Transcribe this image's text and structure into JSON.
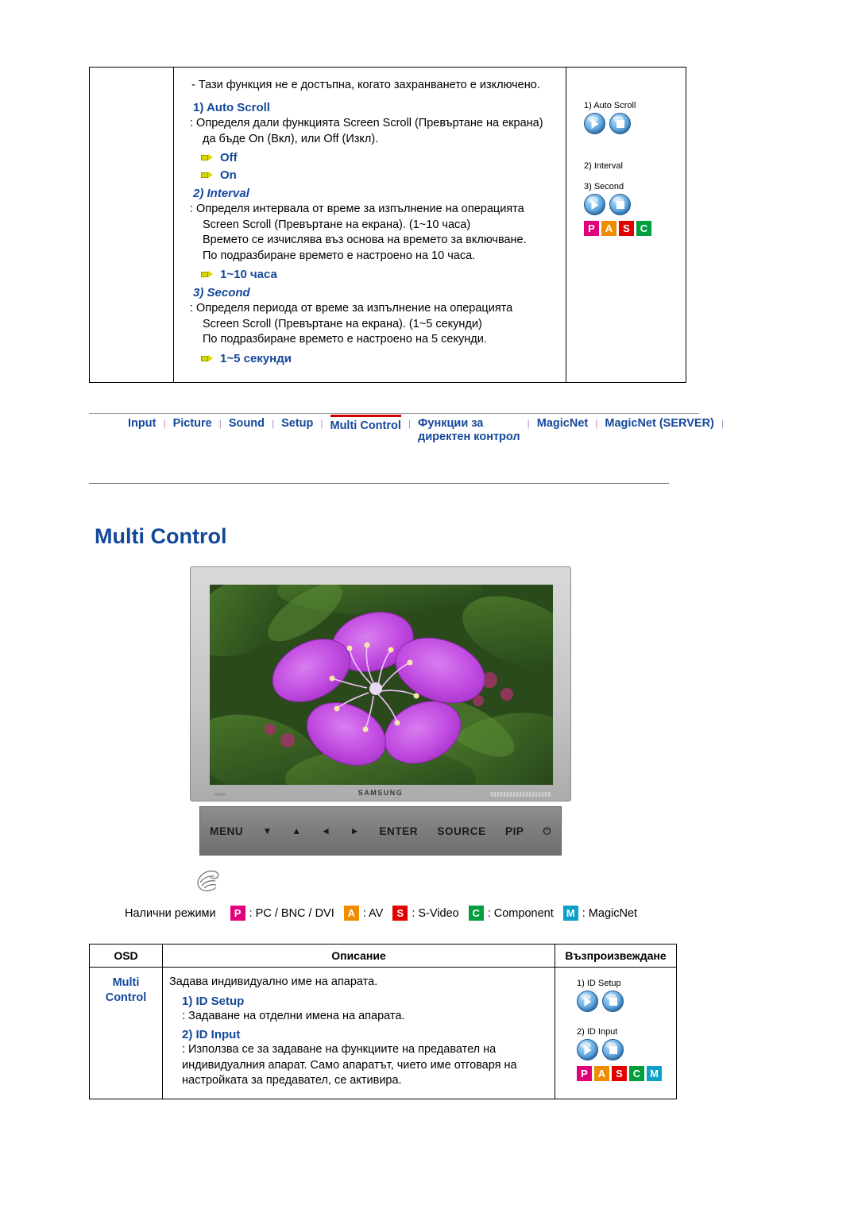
{
  "top_section": {
    "note": "- Тази функция не е достъпна, когато захранването е изключено.",
    "item1_title": "1) Auto Scroll",
    "item1_desc": ": Определя дали функцията Screen Scroll (Превъртане на екрана)\nда бъде On (Вкл), или Off (Изкл).",
    "item1_desc_line1": ": Определя дали функцията Screen Scroll (Превъртане на екрана)",
    "item1_desc_line2": "да бъде On (Вкл), или Off (Изкл).",
    "option_off": "Off",
    "option_on": "On",
    "item2_title": "2) Interval",
    "item2_line1": ": Определя интервала от време за изпълнение на операцията",
    "item2_line2": "Screen Scroll (Превъртане на екрана). (1~10 часа)",
    "item2_line3": "Времето се изчислява въз основа на времето за включване.",
    "item2_line4": "По подразбиране времето е настроено на 10 часа.",
    "option_hours": "1~10 часа",
    "item3_title": "3) Second",
    "item3_line1": ":  Определя периода от време за изпълнение на операцията",
    "item3_line2": "Screen Scroll (Превъртане на екрана). (1~5 секунди)",
    "item3_line3": "По подразбиране времето е настроено на 5 секунди.",
    "option_seconds": "1~5 секунди",
    "icon_label_1": "1) Auto Scroll",
    "icon_label_2": "2) Interval",
    "icon_label_3": "3) Second",
    "tags": [
      "P",
      "A",
      "S",
      "C"
    ]
  },
  "navbar": {
    "items": [
      {
        "label": "Input",
        "active": false
      },
      {
        "label": "Picture",
        "active": false
      },
      {
        "label": "Sound",
        "active": false
      },
      {
        "label": "Setup",
        "active": false
      },
      {
        "label": "Multi Control",
        "active": true
      },
      {
        "label": "Функции за\nдиректен контрол",
        "active": false
      },
      {
        "label": "MagicNet",
        "active": false
      },
      {
        "label": "MagicNet (SERVER)",
        "active": false
      }
    ],
    "item_5_line1": "Функции за",
    "item_5_line2": "директен контрол",
    "separator": "|"
  },
  "page": {
    "heading": "Multi Control"
  },
  "monitor": {
    "brand": "SAMSUNG",
    "buttons": [
      "MENU",
      "▼",
      "▲",
      "◄",
      "►",
      "ENTER",
      "SOURCE",
      "PIP",
      "⏻"
    ]
  },
  "modes": {
    "label": "Налични режими",
    "entries": [
      {
        "tag": "P",
        "tag_class": "p",
        "text": ": PC / BNC / DVI"
      },
      {
        "tag": "A",
        "tag_class": "a",
        "text": ": AV"
      },
      {
        "tag": "S",
        "tag_class": "s",
        "text": ": S-Video"
      },
      {
        "tag": "C",
        "tag_class": "c",
        "text": ": Component"
      },
      {
        "tag": "M",
        "tag_class": "m",
        "text": ": MagicNet"
      }
    ]
  },
  "bottom_table": {
    "headers": [
      "OSD",
      "Описание",
      "Възпроизвеждане"
    ],
    "row": {
      "osd_line1": "Multi",
      "osd_line2": "Control",
      "desc_line1": "Задава индивидуално име на апарата.",
      "sub1": "1) ID Setup",
      "desc_line2": ": Задаване на отделни имена на апарата.",
      "sub2": "2) ID Input",
      "desc_line3": ": Използва се за задаване на функциите на предавател на",
      "desc_line4": "индивидуалния апарат. Само апаратът, чието име отговаря на",
      "desc_line5": "настройката за предавател, се активира.",
      "icon_label_1": "1) ID Setup",
      "icon_label_2": "2) ID Input",
      "tags": [
        "P",
        "A",
        "S",
        "C",
        "M"
      ]
    }
  }
}
